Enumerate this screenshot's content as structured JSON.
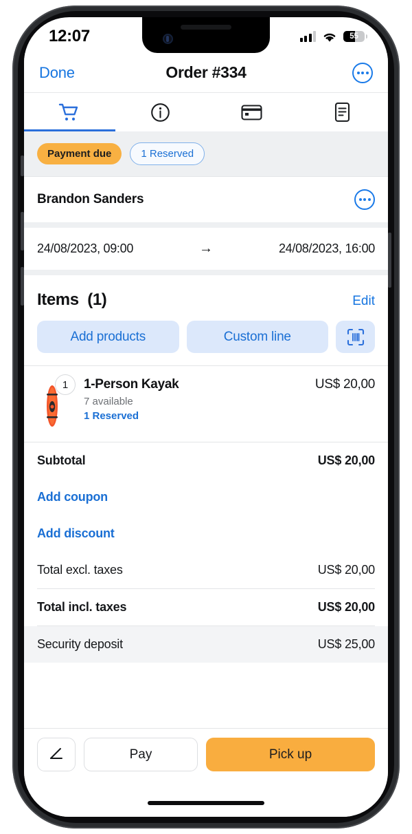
{
  "status_bar": {
    "time": "12:07",
    "battery_level": "55",
    "icons": [
      "signal-icon",
      "wifi-icon",
      "battery-icon"
    ]
  },
  "nav": {
    "done_label": "Done",
    "title": "Order #334",
    "more_icon": "ellipsis-circle-icon"
  },
  "tabs": [
    {
      "name": "cart",
      "icon": "shopping-cart-icon",
      "active": true
    },
    {
      "name": "info",
      "icon": "info-circle-icon",
      "active": false
    },
    {
      "name": "payment",
      "icon": "credit-card-icon",
      "active": false
    },
    {
      "name": "notes",
      "icon": "document-icon",
      "active": false
    }
  ],
  "badges": {
    "payment_status": "Payment due",
    "reserved": "1 Reserved"
  },
  "customer": {
    "name": "Brandon Sanders",
    "more_icon": "ellipsis-circle-icon"
  },
  "dates": {
    "start": "24/08/2023, 09:00",
    "arrow": "→",
    "end": "24/08/2023, 16:00"
  },
  "items_section": {
    "title": "Items",
    "count": "(1)",
    "edit_label": "Edit",
    "add_products_label": "Add products",
    "custom_line_label": "Custom line",
    "scan_icon": "barcode-scan-icon"
  },
  "line_items": [
    {
      "quantity": "1",
      "name": "1-Person Kayak",
      "availability": "7 available",
      "reserved": "1 Reserved",
      "price": "US$ 20,00",
      "image": "kayak-thumbnail"
    }
  ],
  "totals": [
    {
      "label": "Subtotal",
      "value": "US$ 20,00",
      "bold": true
    },
    {
      "label": "Add coupon",
      "value": "",
      "link": true
    },
    {
      "label": "Add discount",
      "value": "",
      "link": true
    },
    {
      "label": "Total excl. taxes",
      "value": "US$ 20,00",
      "bold": false
    },
    {
      "label": "Total incl. taxes",
      "value": "US$ 20,00",
      "bold": true
    },
    {
      "label": "Security deposit",
      "value": "US$ 25,00",
      "bold": false
    }
  ],
  "bottom_bar": {
    "signature_icon": "signature-icon",
    "pay_label": "Pay",
    "pickup_label": "Pick up"
  },
  "colors": {
    "accent_blue": "#1a6fd4",
    "link_blue": "#1675e0",
    "warn_orange": "#f8b042",
    "action_orange": "#f9ad3f",
    "soft_blue_bg": "#dce8fb",
    "section_grey": "#eef0f2"
  }
}
